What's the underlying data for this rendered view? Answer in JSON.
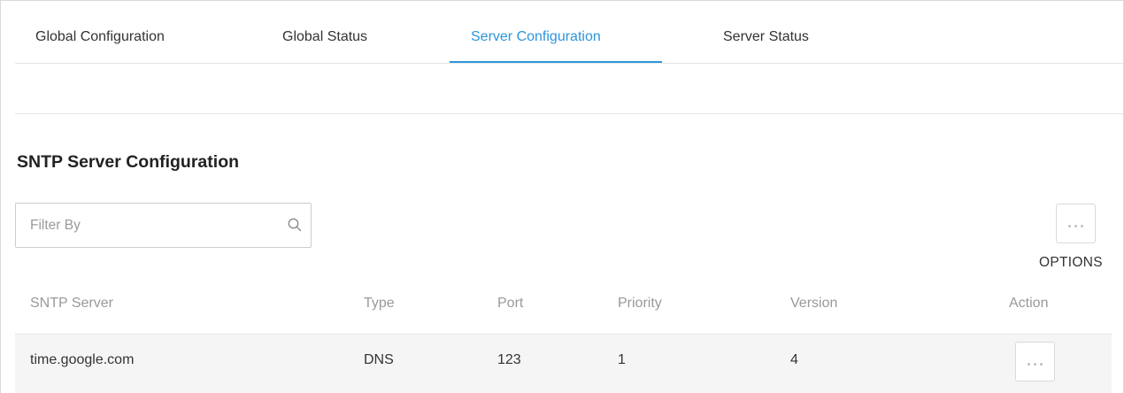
{
  "tabs": [
    {
      "label": "Global Configuration",
      "active": false
    },
    {
      "label": "Global Status",
      "active": false
    },
    {
      "label": "Server Configuration",
      "active": true
    },
    {
      "label": "Server Status",
      "active": false
    }
  ],
  "section": {
    "title": "SNTP Server Configuration"
  },
  "filter": {
    "placeholder": "Filter By",
    "value": "",
    "icon": "search-icon"
  },
  "options": {
    "label": "OPTIONS",
    "icon": "more-horizontal-icon"
  },
  "table": {
    "headers": [
      "SNTP Server",
      "Type",
      "Port",
      "Priority",
      "Version",
      "Action"
    ],
    "rows": [
      {
        "server": "time.google.com",
        "type": "DNS",
        "port": "123",
        "priority": "1",
        "version": "4",
        "action_icon": "more-horizontal-icon"
      }
    ]
  },
  "colors": {
    "accent": "#2c96dc",
    "row_bg": "#f5f5f5",
    "header_text": "#999999"
  }
}
